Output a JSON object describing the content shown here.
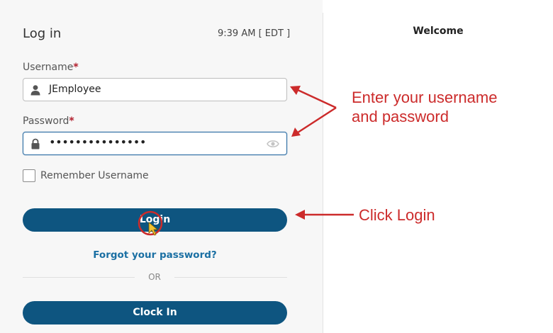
{
  "login": {
    "title": "Log in",
    "time": "9:39 AM [ EDT ]",
    "username_label": "Username",
    "username_value": "JEmployee",
    "password_label": "Password",
    "password_masked": "•••••••••••••••",
    "required_mark": "*",
    "remember_label": "Remember Username",
    "remember_checked": false,
    "login_button": "Login",
    "forgot_link": "Forgot your password?",
    "or_text": "OR",
    "clock_in_button": "Clock In"
  },
  "right_panel": {
    "welcome": "Welcome"
  },
  "annotations": {
    "enter_line1": "Enter your username",
    "enter_line2": "and password",
    "click_login": "Click Login",
    "color": "#cc2b2b"
  },
  "colors": {
    "primary_button": "#0e5580",
    "link": "#1a6fa3",
    "required": "#b21f2d",
    "focus_border": "#2b6ca3"
  }
}
